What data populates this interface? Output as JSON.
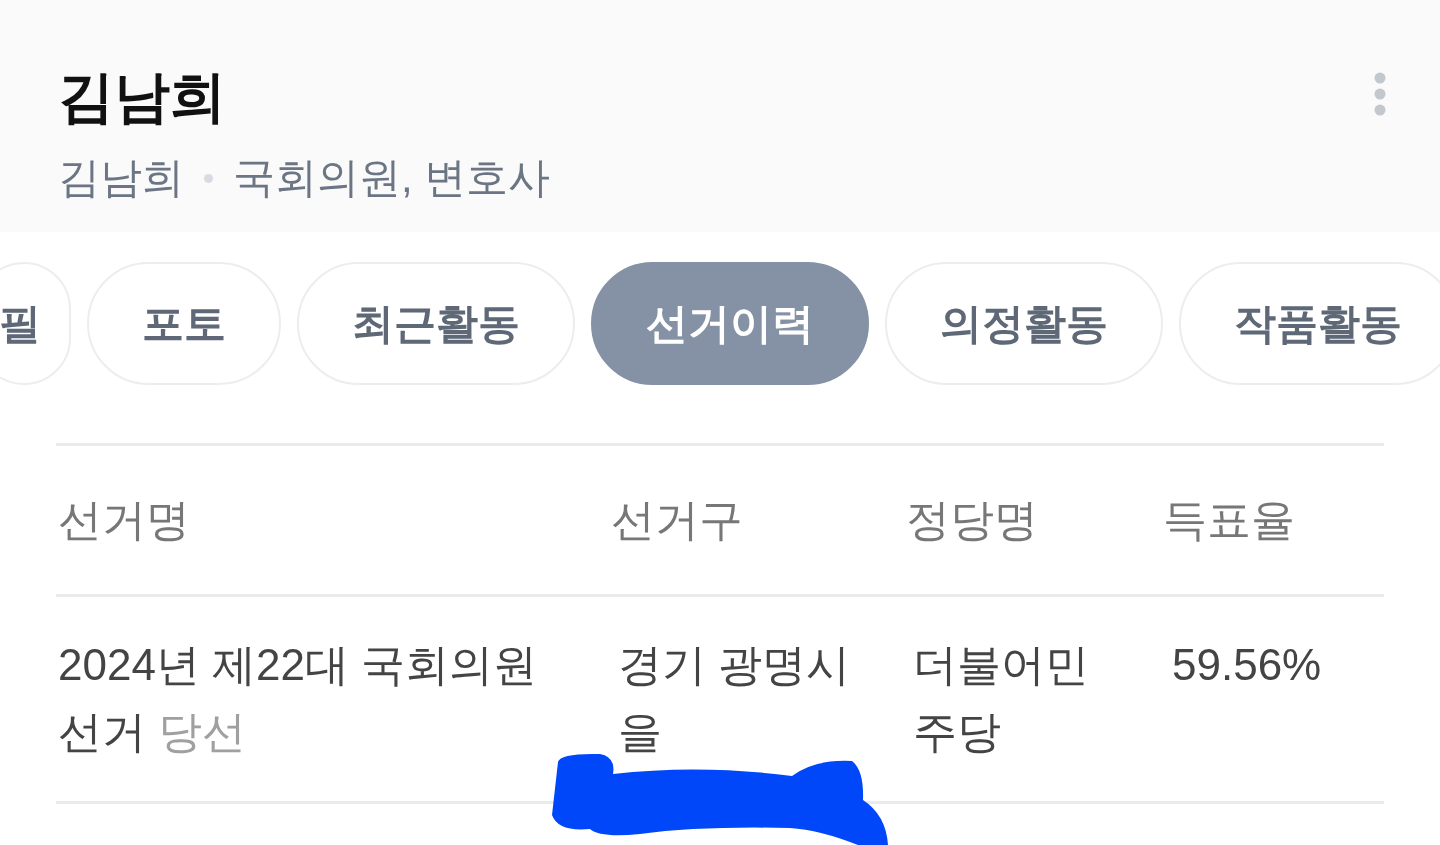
{
  "header": {
    "title": "김남희",
    "subtitle": {
      "name": "김남희",
      "description": "국회의원, 변호사"
    }
  },
  "tabs": [
    {
      "label": "필",
      "selected": false
    },
    {
      "label": "포토",
      "selected": false
    },
    {
      "label": "최근활동",
      "selected": false
    },
    {
      "label": "선거이력",
      "selected": true
    },
    {
      "label": "의정활동",
      "selected": false
    },
    {
      "label": "작품활동",
      "selected": false
    }
  ],
  "table": {
    "columns": [
      "선거명",
      "선거구",
      "정당명",
      "득표율"
    ],
    "rows": [
      {
        "election": "2024년 제22대 국회의원 선거",
        "result": "당선",
        "district": "경기 광명시 을",
        "party": "더불어민주당",
        "vote_share": "59.56%"
      }
    ]
  }
}
